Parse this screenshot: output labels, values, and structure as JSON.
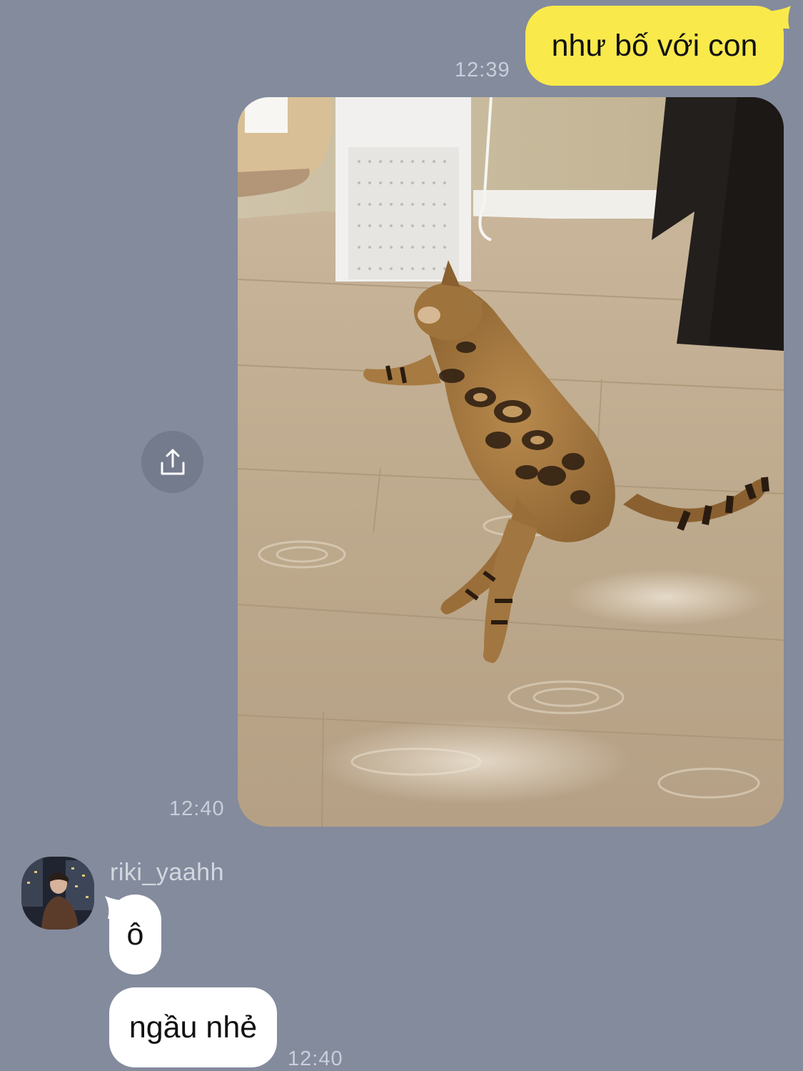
{
  "messages": {
    "outgoing_text": "như bố với con",
    "outgoing_text_time": "12:39",
    "photo_time": "12:40",
    "sender_name": "riki_yaahh",
    "incoming_1": "ô",
    "incoming_2": "ngầu nhẻ",
    "incoming_time": "12:40"
  },
  "icons": {
    "share": "share-icon",
    "avatar": "avatar"
  },
  "colors": {
    "background": "#838b9d",
    "outgoing_bubble": "#f9e94b",
    "incoming_bubble": "#ffffff"
  }
}
